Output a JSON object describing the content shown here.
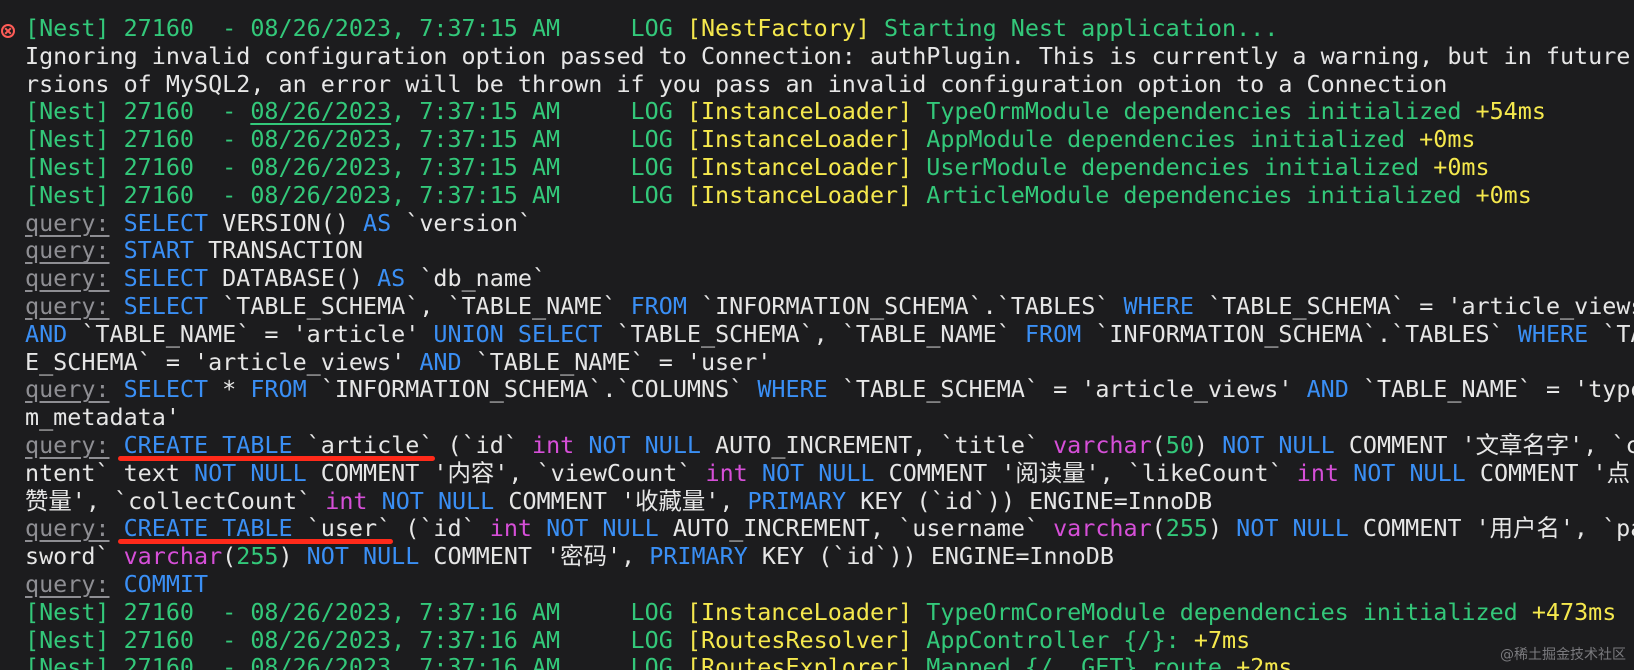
{
  "colors": {
    "background": "#1c1c1e",
    "green": "#33c87a",
    "yellow": "#f5e84d",
    "blue": "#3a8ff5",
    "magenta": "#d64fd8",
    "query_label": "#8e8e93",
    "error_icon": "#ff5c57",
    "annotation_red": "#ff2a1a"
  },
  "icons": {
    "first_line_gutter": "error-circle-x-icon"
  },
  "watermark": "@稀土掘金技术社区",
  "lines": [
    {
      "segs": [
        {
          "t": "[Nest] 27160  - 08/26/2023, 7:37:15 AM     LOG ",
          "c": "green"
        },
        {
          "t": "[NestFactory] ",
          "c": "yellow"
        },
        {
          "t": "Starting Nest application...",
          "c": "green"
        }
      ]
    },
    {
      "segs": [
        {
          "t": "Ignoring invalid configuration option passed to Connection: authPlugin. This is currently a warning, but in future ve",
          "c": "white"
        }
      ]
    },
    {
      "segs": [
        {
          "t": "rsions of MySQL2, an error will be thrown if you pass an invalid configuration option to a Connection",
          "c": "white"
        }
      ]
    },
    {
      "segs": [
        {
          "t": "[Nest] 27160  - ",
          "c": "green"
        },
        {
          "t": "08/26/2023",
          "c": "green",
          "ul": true
        },
        {
          "t": ", 7:37:15 AM     LOG ",
          "c": "green"
        },
        {
          "t": "[InstanceLoader] ",
          "c": "yellow"
        },
        {
          "t": "TypeOrmModule dependencies initialized ",
          "c": "green"
        },
        {
          "t": "+54ms",
          "c": "yellow"
        }
      ]
    },
    {
      "segs": [
        {
          "t": "[Nest] 27160  - 08/26/2023, 7:37:15 AM     LOG ",
          "c": "green"
        },
        {
          "t": "[InstanceLoader] ",
          "c": "yellow"
        },
        {
          "t": "AppModule dependencies initialized ",
          "c": "green"
        },
        {
          "t": "+0ms",
          "c": "yellow"
        }
      ]
    },
    {
      "segs": [
        {
          "t": "[Nest] 27160  - 08/26/2023, 7:37:15 AM     LOG ",
          "c": "green"
        },
        {
          "t": "[InstanceLoader] ",
          "c": "yellow"
        },
        {
          "t": "UserModule dependencies initialized ",
          "c": "green"
        },
        {
          "t": "+0ms",
          "c": "yellow"
        }
      ]
    },
    {
      "segs": [
        {
          "t": "[Nest] 27160  - 08/26/2023, 7:37:15 AM     LOG ",
          "c": "green"
        },
        {
          "t": "[InstanceLoader] ",
          "c": "yellow"
        },
        {
          "t": "ArticleModule dependencies initialized ",
          "c": "green"
        },
        {
          "t": "+0ms",
          "c": "yellow"
        }
      ]
    },
    {
      "segs": [
        {
          "t": "query:",
          "c": "query"
        },
        {
          "t": " ",
          "c": "white"
        },
        {
          "t": "SELECT",
          "c": "blue"
        },
        {
          "t": " VERSION() ",
          "c": "white"
        },
        {
          "t": "AS",
          "c": "blue"
        },
        {
          "t": " `version`",
          "c": "white"
        }
      ]
    },
    {
      "segs": [
        {
          "t": "query:",
          "c": "query"
        },
        {
          "t": " ",
          "c": "white"
        },
        {
          "t": "START",
          "c": "blue"
        },
        {
          "t": " TRANSACTION",
          "c": "white"
        }
      ]
    },
    {
      "segs": [
        {
          "t": "query:",
          "c": "query"
        },
        {
          "t": " ",
          "c": "white"
        },
        {
          "t": "SELECT",
          "c": "blue"
        },
        {
          "t": " DATABASE() ",
          "c": "white"
        },
        {
          "t": "AS",
          "c": "blue"
        },
        {
          "t": " `db_name`",
          "c": "white"
        }
      ]
    },
    {
      "segs": [
        {
          "t": "query:",
          "c": "query"
        },
        {
          "t": " ",
          "c": "white"
        },
        {
          "t": "SELECT",
          "c": "blue"
        },
        {
          "t": " `TABLE_SCHEMA`, `TABLE_NAME` ",
          "c": "white"
        },
        {
          "t": "FROM",
          "c": "blue"
        },
        {
          "t": " `INFORMATION_SCHEMA`.`TABLES` ",
          "c": "white"
        },
        {
          "t": "WHERE",
          "c": "blue"
        },
        {
          "t": " `TABLE_SCHEMA` = 'article_views'",
          "c": "white"
        }
      ]
    },
    {
      "segs": [
        {
          "t": "AND",
          "c": "blue"
        },
        {
          "t": " `TABLE_NAME` = 'article' ",
          "c": "white"
        },
        {
          "t": "UNION",
          "c": "blue"
        },
        {
          "t": " ",
          "c": "white"
        },
        {
          "t": "SELECT",
          "c": "blue"
        },
        {
          "t": " `TABLE_SCHEMA`, `TABLE_NAME` ",
          "c": "white"
        },
        {
          "t": "FROM",
          "c": "blue"
        },
        {
          "t": " `INFORMATION_SCHEMA`.`TABLES` ",
          "c": "white"
        },
        {
          "t": "WHERE",
          "c": "blue"
        },
        {
          "t": " `TABL",
          "c": "white"
        }
      ]
    },
    {
      "segs": [
        {
          "t": "E_SCHEMA` = 'article_views' ",
          "c": "white"
        },
        {
          "t": "AND",
          "c": "blue"
        },
        {
          "t": " `TABLE_NAME` = 'user'",
          "c": "white"
        }
      ]
    },
    {
      "segs": [
        {
          "t": "query:",
          "c": "query"
        },
        {
          "t": " ",
          "c": "white"
        },
        {
          "t": "SELECT",
          "c": "blue"
        },
        {
          "t": " * ",
          "c": "white"
        },
        {
          "t": "FROM",
          "c": "blue"
        },
        {
          "t": " `INFORMATION_SCHEMA`.`COLUMNS` ",
          "c": "white"
        },
        {
          "t": "WHERE",
          "c": "blue"
        },
        {
          "t": " `TABLE_SCHEMA` = 'article_views' ",
          "c": "white"
        },
        {
          "t": "AND",
          "c": "blue"
        },
        {
          "t": " `TABLE_NAME` = 'typeor",
          "c": "white"
        }
      ]
    },
    {
      "segs": [
        {
          "t": "m_metadata'",
          "c": "white"
        }
      ]
    },
    {
      "mark": "create-article",
      "segs": [
        {
          "t": "query:",
          "c": "query"
        },
        {
          "t": " ",
          "c": "white"
        },
        {
          "t": "CREATE TABLE",
          "c": "blue"
        },
        {
          "t": " `article` (`id` ",
          "c": "white"
        },
        {
          "t": "int",
          "c": "magenta"
        },
        {
          "t": " ",
          "c": "white"
        },
        {
          "t": "NOT NULL",
          "c": "blue"
        },
        {
          "t": " AUTO_INCREMENT, `title` ",
          "c": "white"
        },
        {
          "t": "varchar",
          "c": "magenta"
        },
        {
          "t": "(",
          "c": "white"
        },
        {
          "t": "50",
          "c": "num"
        },
        {
          "t": ") ",
          "c": "white"
        },
        {
          "t": "NOT NULL",
          "c": "blue"
        },
        {
          "t": " COMMENT '文章名字', `co",
          "c": "white"
        }
      ]
    },
    {
      "segs": [
        {
          "t": "ntent` text ",
          "c": "white"
        },
        {
          "t": "NOT NULL",
          "c": "blue"
        },
        {
          "t": " COMMENT '内容', `viewCount` ",
          "c": "white"
        },
        {
          "t": "int",
          "c": "magenta"
        },
        {
          "t": " ",
          "c": "white"
        },
        {
          "t": "NOT NULL",
          "c": "blue"
        },
        {
          "t": " COMMENT '阅读量', `likeCount` ",
          "c": "white"
        },
        {
          "t": "int",
          "c": "magenta"
        },
        {
          "t": " ",
          "c": "white"
        },
        {
          "t": "NOT NULL",
          "c": "blue"
        },
        {
          "t": " COMMENT '点",
          "c": "white"
        }
      ]
    },
    {
      "segs": [
        {
          "t": "赞量', `collectCount` ",
          "c": "white"
        },
        {
          "t": "int",
          "c": "magenta"
        },
        {
          "t": " ",
          "c": "white"
        },
        {
          "t": "NOT NULL",
          "c": "blue"
        },
        {
          "t": " COMMENT '收藏量', ",
          "c": "white"
        },
        {
          "t": "PRIMARY",
          "c": "blue"
        },
        {
          "t": " KEY (`id`)) ENGINE=InnoDB",
          "c": "white"
        }
      ]
    },
    {
      "mark": "create-user",
      "segs": [
        {
          "t": "query:",
          "c": "query"
        },
        {
          "t": " ",
          "c": "white"
        },
        {
          "t": "CREATE TABLE",
          "c": "blue"
        },
        {
          "t": " `user` (`id` ",
          "c": "white"
        },
        {
          "t": "int",
          "c": "magenta"
        },
        {
          "t": " ",
          "c": "white"
        },
        {
          "t": "NOT NULL",
          "c": "blue"
        },
        {
          "t": " AUTO_INCREMENT, `username` ",
          "c": "white"
        },
        {
          "t": "varchar",
          "c": "magenta"
        },
        {
          "t": "(",
          "c": "white"
        },
        {
          "t": "255",
          "c": "num"
        },
        {
          "t": ") ",
          "c": "white"
        },
        {
          "t": "NOT NULL",
          "c": "blue"
        },
        {
          "t": " COMMENT '用户名', `pas",
          "c": "white"
        }
      ]
    },
    {
      "segs": [
        {
          "t": "sword` ",
          "c": "white"
        },
        {
          "t": "varchar",
          "c": "magenta"
        },
        {
          "t": "(",
          "c": "white"
        },
        {
          "t": "255",
          "c": "num"
        },
        {
          "t": ") ",
          "c": "white"
        },
        {
          "t": "NOT NULL",
          "c": "blue"
        },
        {
          "t": " COMMENT '密码', ",
          "c": "white"
        },
        {
          "t": "PRIMARY",
          "c": "blue"
        },
        {
          "t": " KEY (`id`)) ENGINE=InnoDB",
          "c": "white"
        }
      ]
    },
    {
      "segs": [
        {
          "t": "query:",
          "c": "query"
        },
        {
          "t": " ",
          "c": "white"
        },
        {
          "t": "COMMIT",
          "c": "blue"
        }
      ]
    },
    {
      "segs": [
        {
          "t": "[Nest] 27160  - 08/26/2023, 7:37:16 AM     LOG ",
          "c": "green"
        },
        {
          "t": "[InstanceLoader] ",
          "c": "yellow"
        },
        {
          "t": "TypeOrmCoreModule dependencies initialized ",
          "c": "green"
        },
        {
          "t": "+473ms",
          "c": "yellow"
        }
      ]
    },
    {
      "segs": [
        {
          "t": "[Nest] 27160  - 08/26/2023, 7:37:16 AM     LOG ",
          "c": "green"
        },
        {
          "t": "[RoutesResolver] ",
          "c": "yellow"
        },
        {
          "t": "AppController {/}: ",
          "c": "green"
        },
        {
          "t": "+7ms",
          "c": "yellow"
        }
      ]
    },
    {
      "segs": [
        {
          "t": "[Nest] 27160  - 08/26/2023, 7:37:16 AM     LOG ",
          "c": "green"
        },
        {
          "t": "[RoutesExplorer] ",
          "c": "yellow"
        },
        {
          "t": "Mapped {/, GET} route ",
          "c": "green"
        },
        {
          "t": "+2ms",
          "c": "yellow"
        }
      ]
    }
  ]
}
